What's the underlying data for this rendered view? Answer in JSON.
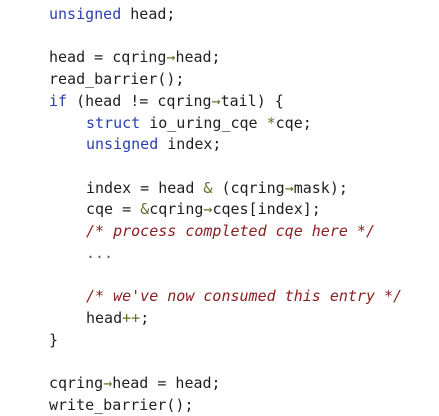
{
  "code_lines": [
    {
      "indent": 0,
      "tokens": [
        {
          "t": "unsigned",
          "k": "kw"
        },
        {
          "t": " head;",
          "k": "plain"
        }
      ]
    },
    {
      "indent": 0,
      "tokens": []
    },
    {
      "indent": 0,
      "tokens": [
        {
          "t": "head = cqring",
          "k": "plain"
        },
        {
          "t": "→",
          "k": "op"
        },
        {
          "t": "head;",
          "k": "plain"
        }
      ]
    },
    {
      "indent": 0,
      "tokens": [
        {
          "t": "read_barrier();",
          "k": "plain"
        }
      ]
    },
    {
      "indent": 0,
      "tokens": [
        {
          "t": "if",
          "k": "kw"
        },
        {
          "t": " (head != cqring",
          "k": "plain"
        },
        {
          "t": "→",
          "k": "op"
        },
        {
          "t": "tail) {",
          "k": "plain"
        }
      ]
    },
    {
      "indent": 1,
      "tokens": [
        {
          "t": "struct",
          "k": "kw"
        },
        {
          "t": " io_uring_cqe ",
          "k": "plain"
        },
        {
          "t": "*",
          "k": "op"
        },
        {
          "t": "cqe;",
          "k": "plain"
        }
      ]
    },
    {
      "indent": 1,
      "tokens": [
        {
          "t": "unsigned",
          "k": "kw"
        },
        {
          "t": " index;",
          "k": "plain"
        }
      ]
    },
    {
      "indent": 0,
      "tokens": []
    },
    {
      "indent": 1,
      "tokens": [
        {
          "t": "index = head ",
          "k": "plain"
        },
        {
          "t": "&",
          "k": "op"
        },
        {
          "t": " (cqring",
          "k": "plain"
        },
        {
          "t": "→",
          "k": "op"
        },
        {
          "t": "mask);",
          "k": "plain"
        }
      ]
    },
    {
      "indent": 1,
      "tokens": [
        {
          "t": "cqe = ",
          "k": "plain"
        },
        {
          "t": "&",
          "k": "op"
        },
        {
          "t": "cqring",
          "k": "plain"
        },
        {
          "t": "→",
          "k": "op"
        },
        {
          "t": "cqes[index];",
          "k": "plain"
        }
      ]
    },
    {
      "indent": 1,
      "tokens": [
        {
          "t": "/* process completed cqe here */",
          "k": "cm"
        }
      ]
    },
    {
      "indent": 1,
      "tokens": [
        {
          "t": "...",
          "k": "ph"
        }
      ]
    },
    {
      "indent": 0,
      "tokens": []
    },
    {
      "indent": 1,
      "tokens": [
        {
          "t": "/* we've now consumed this entry */",
          "k": "cm"
        }
      ]
    },
    {
      "indent": 1,
      "tokens": [
        {
          "t": "head",
          "k": "plain"
        },
        {
          "t": "++",
          "k": "op"
        },
        {
          "t": ";",
          "k": "plain"
        }
      ]
    },
    {
      "indent": 0,
      "tokens": [
        {
          "t": "}",
          "k": "plain"
        }
      ]
    },
    {
      "indent": 0,
      "tokens": []
    },
    {
      "indent": 0,
      "tokens": [
        {
          "t": "cqring",
          "k": "plain"
        },
        {
          "t": "→",
          "k": "op"
        },
        {
          "t": "head = head;",
          "k": "plain"
        }
      ]
    },
    {
      "indent": 0,
      "tokens": [
        {
          "t": "write_barrier();",
          "k": "plain"
        }
      ]
    }
  ],
  "colors": {
    "background": "#ffffff",
    "keyword": "#2a3fb0",
    "comment": "#8a2020",
    "operator": "#6b6b2a",
    "text": "#1f1f1f"
  }
}
